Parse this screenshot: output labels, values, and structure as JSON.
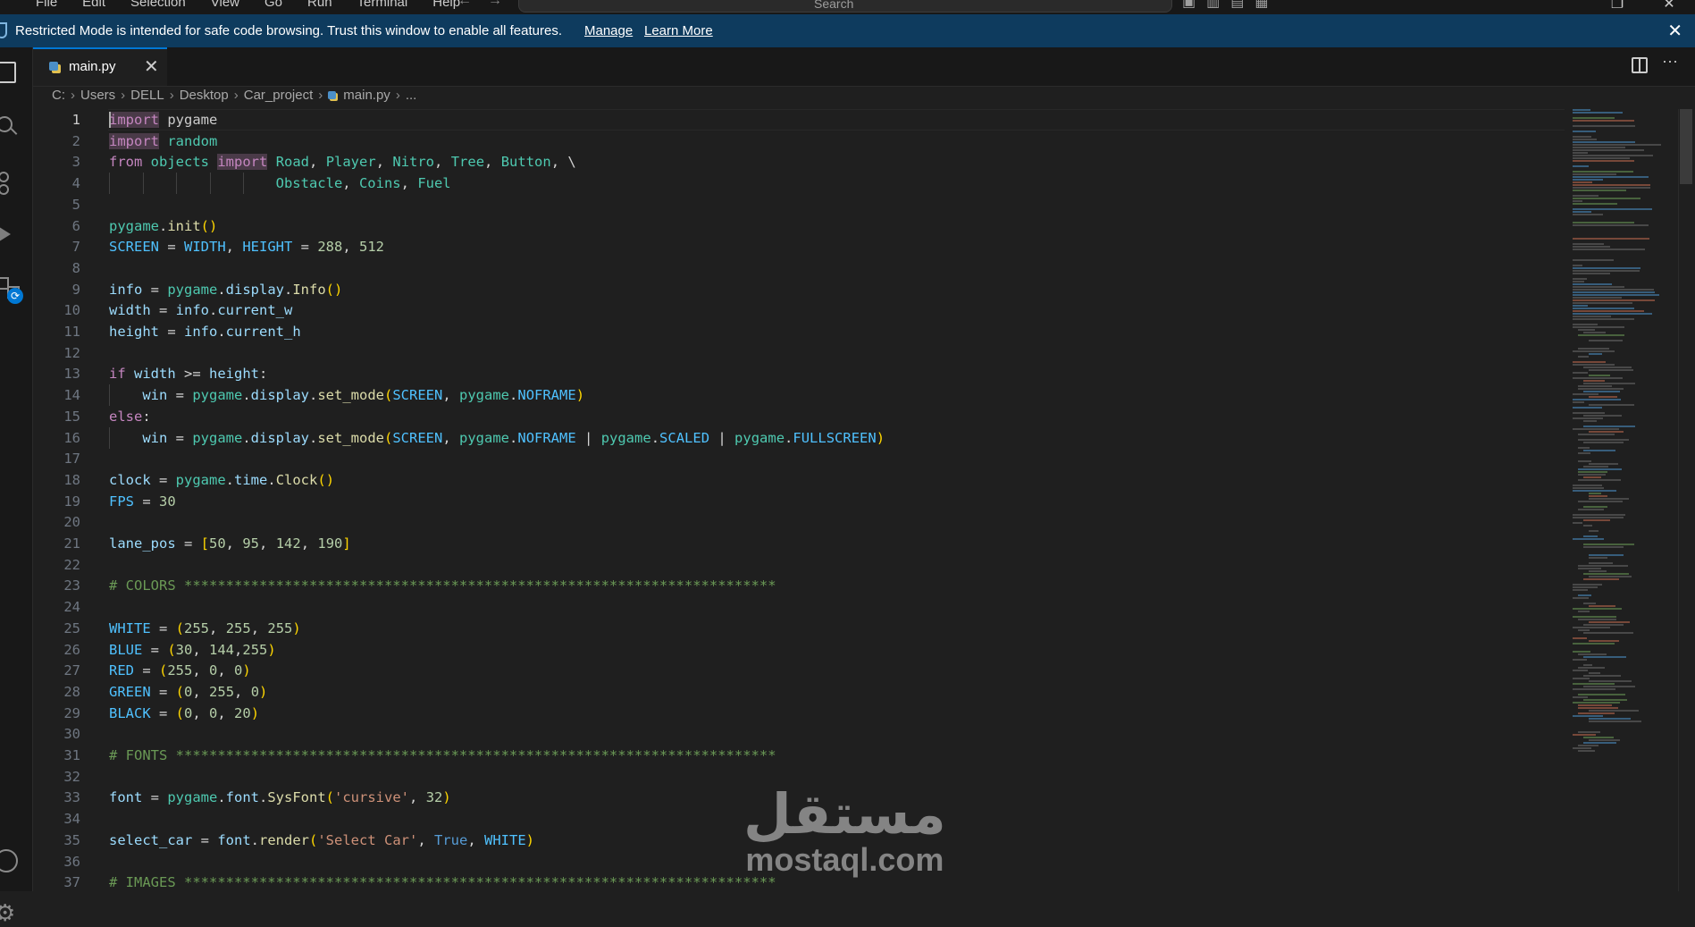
{
  "titlebar": {
    "menu": [
      "File",
      "Edit",
      "Selection",
      "View",
      "Go",
      "Run",
      "Terminal",
      "Help"
    ],
    "search_placeholder": "Search"
  },
  "banner": {
    "message": "Restricted Mode is intended for safe code browsing. Trust this window to enable all features.",
    "manage_label": "Manage",
    "learn_more_label": "Learn More"
  },
  "activity_bar": {
    "icons": [
      "files-icon",
      "search-icon",
      "source-control-icon",
      "run-debug-icon",
      "extensions-icon",
      "account-icon",
      "settings-icon"
    ]
  },
  "tab": {
    "label": "main.py"
  },
  "breadcrumb": [
    "C:",
    "Users",
    "DELL",
    "Desktop",
    "Car_project",
    "main.py",
    "..."
  ],
  "editor": {
    "lines": [
      {
        "n": "1",
        "active": true,
        "t": [
          [
            "kw-imp hl",
            "import"
          ],
          [
            "",
            " pygame"
          ]
        ]
      },
      {
        "n": "2",
        "t": [
          [
            "kw-imp hl",
            "import"
          ],
          [
            "",
            " "
          ],
          [
            "mod",
            "random"
          ]
        ]
      },
      {
        "n": "3",
        "t": [
          [
            "kw-imp",
            "from"
          ],
          [
            "",
            " "
          ],
          [
            "mod",
            "objects"
          ],
          [
            "",
            " "
          ],
          [
            "kw-imp hl",
            "import"
          ],
          [
            "",
            " "
          ],
          [
            "mod",
            "Road"
          ],
          [
            "op",
            ", "
          ],
          [
            "mod",
            "Player"
          ],
          [
            "op",
            ", "
          ],
          [
            "mod",
            "Nitro"
          ],
          [
            "op",
            ", "
          ],
          [
            "mod",
            "Tree"
          ],
          [
            "op",
            ", "
          ],
          [
            "mod",
            "Button"
          ],
          [
            "op",
            ", \\"
          ]
        ]
      },
      {
        "n": "4",
        "guides": 5,
        "t": [
          [
            "",
            "                    "
          ],
          [
            "mod",
            "Obstacle"
          ],
          [
            "op",
            ", "
          ],
          [
            "mod",
            "Coins"
          ],
          [
            "op",
            ", "
          ],
          [
            "mod",
            "Fuel"
          ]
        ]
      },
      {
        "n": "5",
        "t": []
      },
      {
        "n": "6",
        "t": [
          [
            "mod",
            "pygame"
          ],
          [
            "op",
            "."
          ],
          [
            "fn",
            "init"
          ],
          [
            "pn",
            "()"
          ]
        ]
      },
      {
        "n": "7",
        "t": [
          [
            "const",
            "SCREEN"
          ],
          [
            "op",
            " = "
          ],
          [
            "const",
            "WIDTH"
          ],
          [
            "op",
            ", "
          ],
          [
            "const",
            "HEIGHT"
          ],
          [
            "op",
            " = "
          ],
          [
            "num",
            "288"
          ],
          [
            "op",
            ", "
          ],
          [
            "num",
            "512"
          ]
        ]
      },
      {
        "n": "8",
        "t": []
      },
      {
        "n": "9",
        "t": [
          [
            "var",
            "info"
          ],
          [
            "op",
            " = "
          ],
          [
            "mod",
            "pygame"
          ],
          [
            "op",
            "."
          ],
          [
            "var",
            "display"
          ],
          [
            "op",
            "."
          ],
          [
            "fn",
            "Info"
          ],
          [
            "pn",
            "()"
          ]
        ]
      },
      {
        "n": "10",
        "t": [
          [
            "var",
            "width"
          ],
          [
            "op",
            " = "
          ],
          [
            "var",
            "info"
          ],
          [
            "op",
            "."
          ],
          [
            "var",
            "current_w"
          ]
        ]
      },
      {
        "n": "11",
        "t": [
          [
            "var",
            "height"
          ],
          [
            "op",
            " = "
          ],
          [
            "var",
            "info"
          ],
          [
            "op",
            "."
          ],
          [
            "var",
            "current_h"
          ]
        ]
      },
      {
        "n": "12",
        "t": []
      },
      {
        "n": "13",
        "t": [
          [
            "kw-ctl",
            "if"
          ],
          [
            "",
            " "
          ],
          [
            "var",
            "width"
          ],
          [
            "op",
            " >= "
          ],
          [
            "var",
            "height"
          ],
          [
            "op",
            ":"
          ]
        ]
      },
      {
        "n": "14",
        "guides": 1,
        "t": [
          [
            "",
            "    "
          ],
          [
            "var",
            "win"
          ],
          [
            "op",
            " = "
          ],
          [
            "mod",
            "pygame"
          ],
          [
            "op",
            "."
          ],
          [
            "var",
            "display"
          ],
          [
            "op",
            "."
          ],
          [
            "fn",
            "set_mode"
          ],
          [
            "pn",
            "("
          ],
          [
            "const",
            "SCREEN"
          ],
          [
            "op",
            ", "
          ],
          [
            "mod",
            "pygame"
          ],
          [
            "op",
            "."
          ],
          [
            "const",
            "NOFRAME"
          ],
          [
            "pn",
            ")"
          ]
        ]
      },
      {
        "n": "15",
        "t": [
          [
            "kw-ctl",
            "else"
          ],
          [
            "op",
            ":"
          ]
        ]
      },
      {
        "n": "16",
        "guides": 1,
        "t": [
          [
            "",
            "    "
          ],
          [
            "var",
            "win"
          ],
          [
            "op",
            " = "
          ],
          [
            "mod",
            "pygame"
          ],
          [
            "op",
            "."
          ],
          [
            "var",
            "display"
          ],
          [
            "op",
            "."
          ],
          [
            "fn",
            "set_mode"
          ],
          [
            "pn",
            "("
          ],
          [
            "const",
            "SCREEN"
          ],
          [
            "op",
            ", "
          ],
          [
            "mod",
            "pygame"
          ],
          [
            "op",
            "."
          ],
          [
            "const",
            "NOFRAME"
          ],
          [
            "op",
            " | "
          ],
          [
            "mod",
            "pygame"
          ],
          [
            "op",
            "."
          ],
          [
            "const",
            "SCALED"
          ],
          [
            "op",
            " | "
          ],
          [
            "mod",
            "pygame"
          ],
          [
            "op",
            "."
          ],
          [
            "const",
            "FULLSCREEN"
          ],
          [
            "pn",
            ")"
          ]
        ]
      },
      {
        "n": "17",
        "t": []
      },
      {
        "n": "18",
        "t": [
          [
            "var",
            "clock"
          ],
          [
            "op",
            " = "
          ],
          [
            "mod",
            "pygame"
          ],
          [
            "op",
            "."
          ],
          [
            "var",
            "time"
          ],
          [
            "op",
            "."
          ],
          [
            "fn",
            "Clock"
          ],
          [
            "pn",
            "()"
          ]
        ]
      },
      {
        "n": "19",
        "t": [
          [
            "const",
            "FPS"
          ],
          [
            "op",
            " = "
          ],
          [
            "num",
            "30"
          ]
        ]
      },
      {
        "n": "20",
        "t": []
      },
      {
        "n": "21",
        "t": [
          [
            "var",
            "lane_pos"
          ],
          [
            "op",
            " = "
          ],
          [
            "pn",
            "["
          ],
          [
            "num",
            "50"
          ],
          [
            "op",
            ", "
          ],
          [
            "num",
            "95"
          ],
          [
            "op",
            ", "
          ],
          [
            "num",
            "142"
          ],
          [
            "op",
            ", "
          ],
          [
            "num",
            "190"
          ],
          [
            "pn",
            "]"
          ]
        ]
      },
      {
        "n": "22",
        "t": []
      },
      {
        "n": "23",
        "t": [
          [
            "cmt",
            "# COLORS ***********************************************************************"
          ]
        ]
      },
      {
        "n": "24",
        "t": []
      },
      {
        "n": "25",
        "t": [
          [
            "const",
            "WHITE"
          ],
          [
            "op",
            " = "
          ],
          [
            "pn",
            "("
          ],
          [
            "num",
            "255"
          ],
          [
            "op",
            ", "
          ],
          [
            "num",
            "255"
          ],
          [
            "op",
            ", "
          ],
          [
            "num",
            "255"
          ],
          [
            "pn",
            ")"
          ]
        ]
      },
      {
        "n": "26",
        "t": [
          [
            "const",
            "BLUE"
          ],
          [
            "op",
            " = "
          ],
          [
            "pn",
            "("
          ],
          [
            "num",
            "30"
          ],
          [
            "op",
            ", "
          ],
          [
            "num",
            "144"
          ],
          [
            "op",
            ","
          ],
          [
            "num",
            "255"
          ],
          [
            "pn",
            ")"
          ]
        ]
      },
      {
        "n": "27",
        "t": [
          [
            "const",
            "RED"
          ],
          [
            "op",
            " = "
          ],
          [
            "pn",
            "("
          ],
          [
            "num",
            "255"
          ],
          [
            "op",
            ", "
          ],
          [
            "num",
            "0"
          ],
          [
            "op",
            ", "
          ],
          [
            "num",
            "0"
          ],
          [
            "pn",
            ")"
          ]
        ]
      },
      {
        "n": "28",
        "t": [
          [
            "const",
            "GREEN"
          ],
          [
            "op",
            " = "
          ],
          [
            "pn",
            "("
          ],
          [
            "num",
            "0"
          ],
          [
            "op",
            ", "
          ],
          [
            "num",
            "255"
          ],
          [
            "op",
            ", "
          ],
          [
            "num",
            "0"
          ],
          [
            "pn",
            ")"
          ]
        ]
      },
      {
        "n": "29",
        "t": [
          [
            "const",
            "BLACK"
          ],
          [
            "op",
            " = "
          ],
          [
            "pn",
            "("
          ],
          [
            "num",
            "0"
          ],
          [
            "op",
            ", "
          ],
          [
            "num",
            "0"
          ],
          [
            "op",
            ", "
          ],
          [
            "num",
            "20"
          ],
          [
            "pn",
            ")"
          ]
        ]
      },
      {
        "n": "30",
        "t": []
      },
      {
        "n": "31",
        "t": [
          [
            "cmt",
            "# FONTS ************************************************************************"
          ]
        ]
      },
      {
        "n": "32",
        "t": []
      },
      {
        "n": "33",
        "t": [
          [
            "var",
            "font"
          ],
          [
            "op",
            " = "
          ],
          [
            "mod",
            "pygame"
          ],
          [
            "op",
            "."
          ],
          [
            "var",
            "font"
          ],
          [
            "op",
            "."
          ],
          [
            "fn",
            "SysFont"
          ],
          [
            "pn",
            "("
          ],
          [
            "str",
            "'cursive'"
          ],
          [
            "op",
            ", "
          ],
          [
            "num",
            "32"
          ],
          [
            "pn",
            ")"
          ]
        ]
      },
      {
        "n": "34",
        "t": []
      },
      {
        "n": "35",
        "t": [
          [
            "var",
            "select_car"
          ],
          [
            "op",
            " = "
          ],
          [
            "var",
            "font"
          ],
          [
            "op",
            "."
          ],
          [
            "fn",
            "render"
          ],
          [
            "pn",
            "("
          ],
          [
            "str",
            "'Select Car'"
          ],
          [
            "op",
            ", "
          ],
          [
            "bool",
            "True"
          ],
          [
            "op",
            ", "
          ],
          [
            "const",
            "WHITE"
          ],
          [
            "pn",
            ")"
          ]
        ]
      },
      {
        "n": "36",
        "t": []
      },
      {
        "n": "37",
        "t": [
          [
            "cmt",
            "# IMAGES ***********************************************************************"
          ]
        ]
      }
    ]
  },
  "watermark": {
    "arabic": "مستقل",
    "latin": "mostaql.com"
  },
  "colors": {
    "background": "#1f1f1f",
    "banner": "#0e3b5e",
    "accent": "#0078d4",
    "keyword": "#c586c0",
    "module": "#4ec9b0",
    "variable": "#9cdcfe",
    "constant": "#4fc1ff",
    "function": "#dcdcaa",
    "number": "#b5cea8",
    "string": "#ce9178",
    "comment": "#6a9955"
  }
}
